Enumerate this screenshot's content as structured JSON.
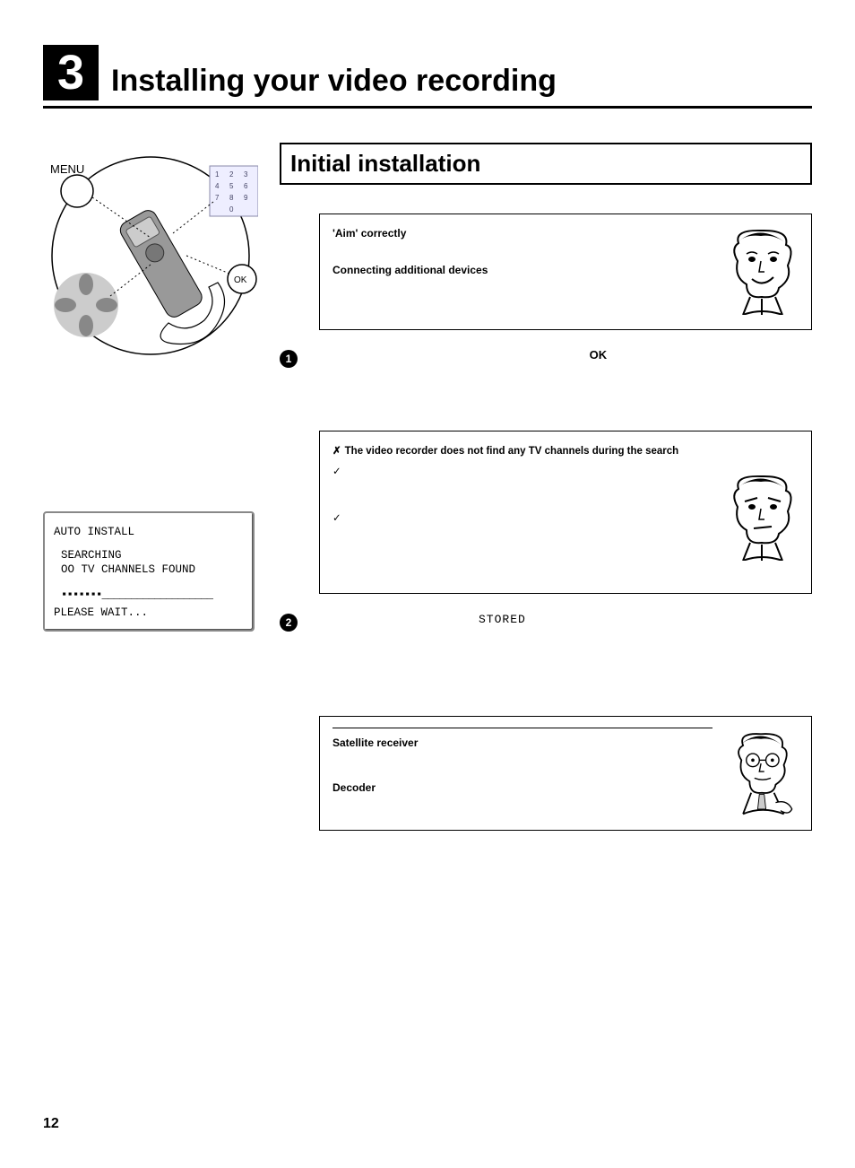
{
  "chapter": {
    "number": "3",
    "title": "Installing your video recording"
  },
  "section": {
    "title": "Initial installation"
  },
  "tip1": {
    "heading1": "'Aim' correctly",
    "heading2": "Connecting additional devices"
  },
  "step1": {
    "num": "1",
    "key": "OK"
  },
  "trouble": {
    "x_heading": "The video recorder does not find any TV channels during the search"
  },
  "step2": {
    "num": "2",
    "label": "STORED"
  },
  "info": {
    "h1": "Satellite receiver",
    "h2": "Decoder"
  },
  "remote": {
    "menu_label": "MENU",
    "ok_label": "OK",
    "keys": [
      "1",
      "2",
      "3",
      "4",
      "5",
      "6",
      "7",
      "8",
      "9",
      "0"
    ]
  },
  "screen": {
    "title": "AUTO INSTALL",
    "line2": "SEARCHING",
    "line3": "OO TV CHANNELS FOUND",
    "bar": "▪▪▪▪▪▪▪___________________",
    "wait": "PLEASE WAIT..."
  },
  "page": "12"
}
